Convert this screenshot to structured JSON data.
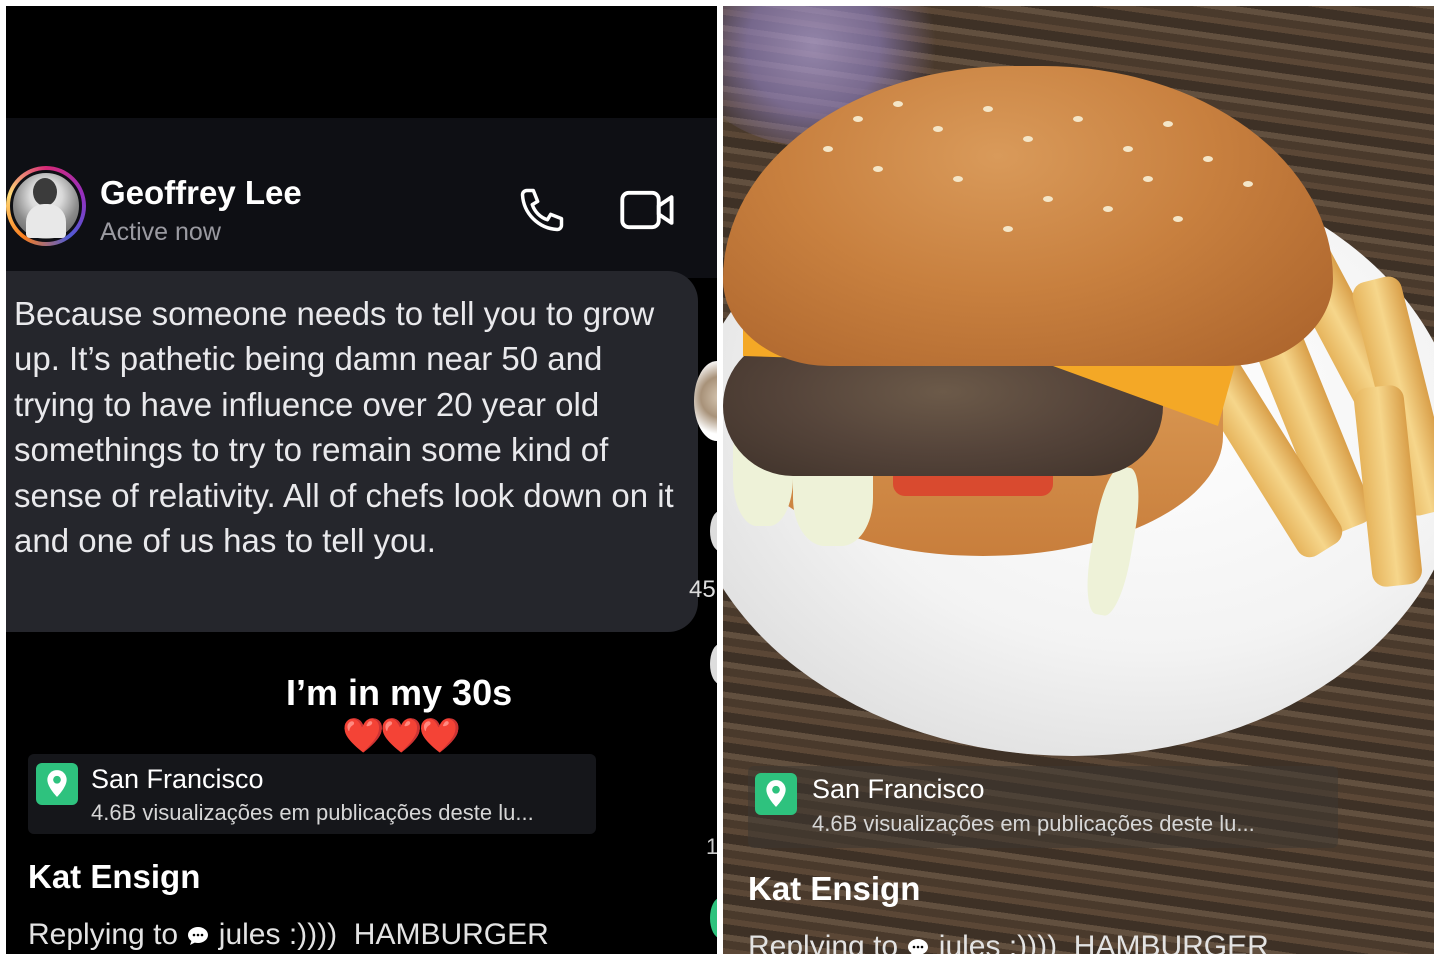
{
  "left_panel": {
    "contact": {
      "name": "Geoffrey Lee",
      "status": "Active now"
    },
    "message": "Because someone needs to tell you to grow up. It’s pathetic being damn near 50 and trying to have influence over 20 year old somethings to try to remain some kind of sense of relativity. All of chefs look down on it and one of us has to tell you.",
    "side_counter": "45",
    "side_counter_2": "1",
    "caption": "I’m in my 30s",
    "hearts": "❤️❤️❤️",
    "location": {
      "title": "San Francisco",
      "subtitle": "4.6B visualizações em publicações deste lu..."
    },
    "username": "Kat Ensign",
    "reply": {
      "prefix": "Replying to",
      "target": "jules :))))",
      "text": "HAMBURGER"
    }
  },
  "right_panel": {
    "location": {
      "title": "San Francisco",
      "subtitle": "4.6B visualizações em publicações deste lu..."
    },
    "username": "Kat Ensign",
    "reply": {
      "prefix": "Replying to",
      "target": "jules :))))",
      "text": "HAMBURGER"
    }
  },
  "icons": {
    "call": "phone-icon",
    "video": "video-camera-icon",
    "location": "map-pin-icon",
    "reply": "chat-bubble-icon"
  },
  "colors": {
    "accent_green": "#2ec27e",
    "bubble": "#25262c",
    "header": "#0e0f14"
  }
}
